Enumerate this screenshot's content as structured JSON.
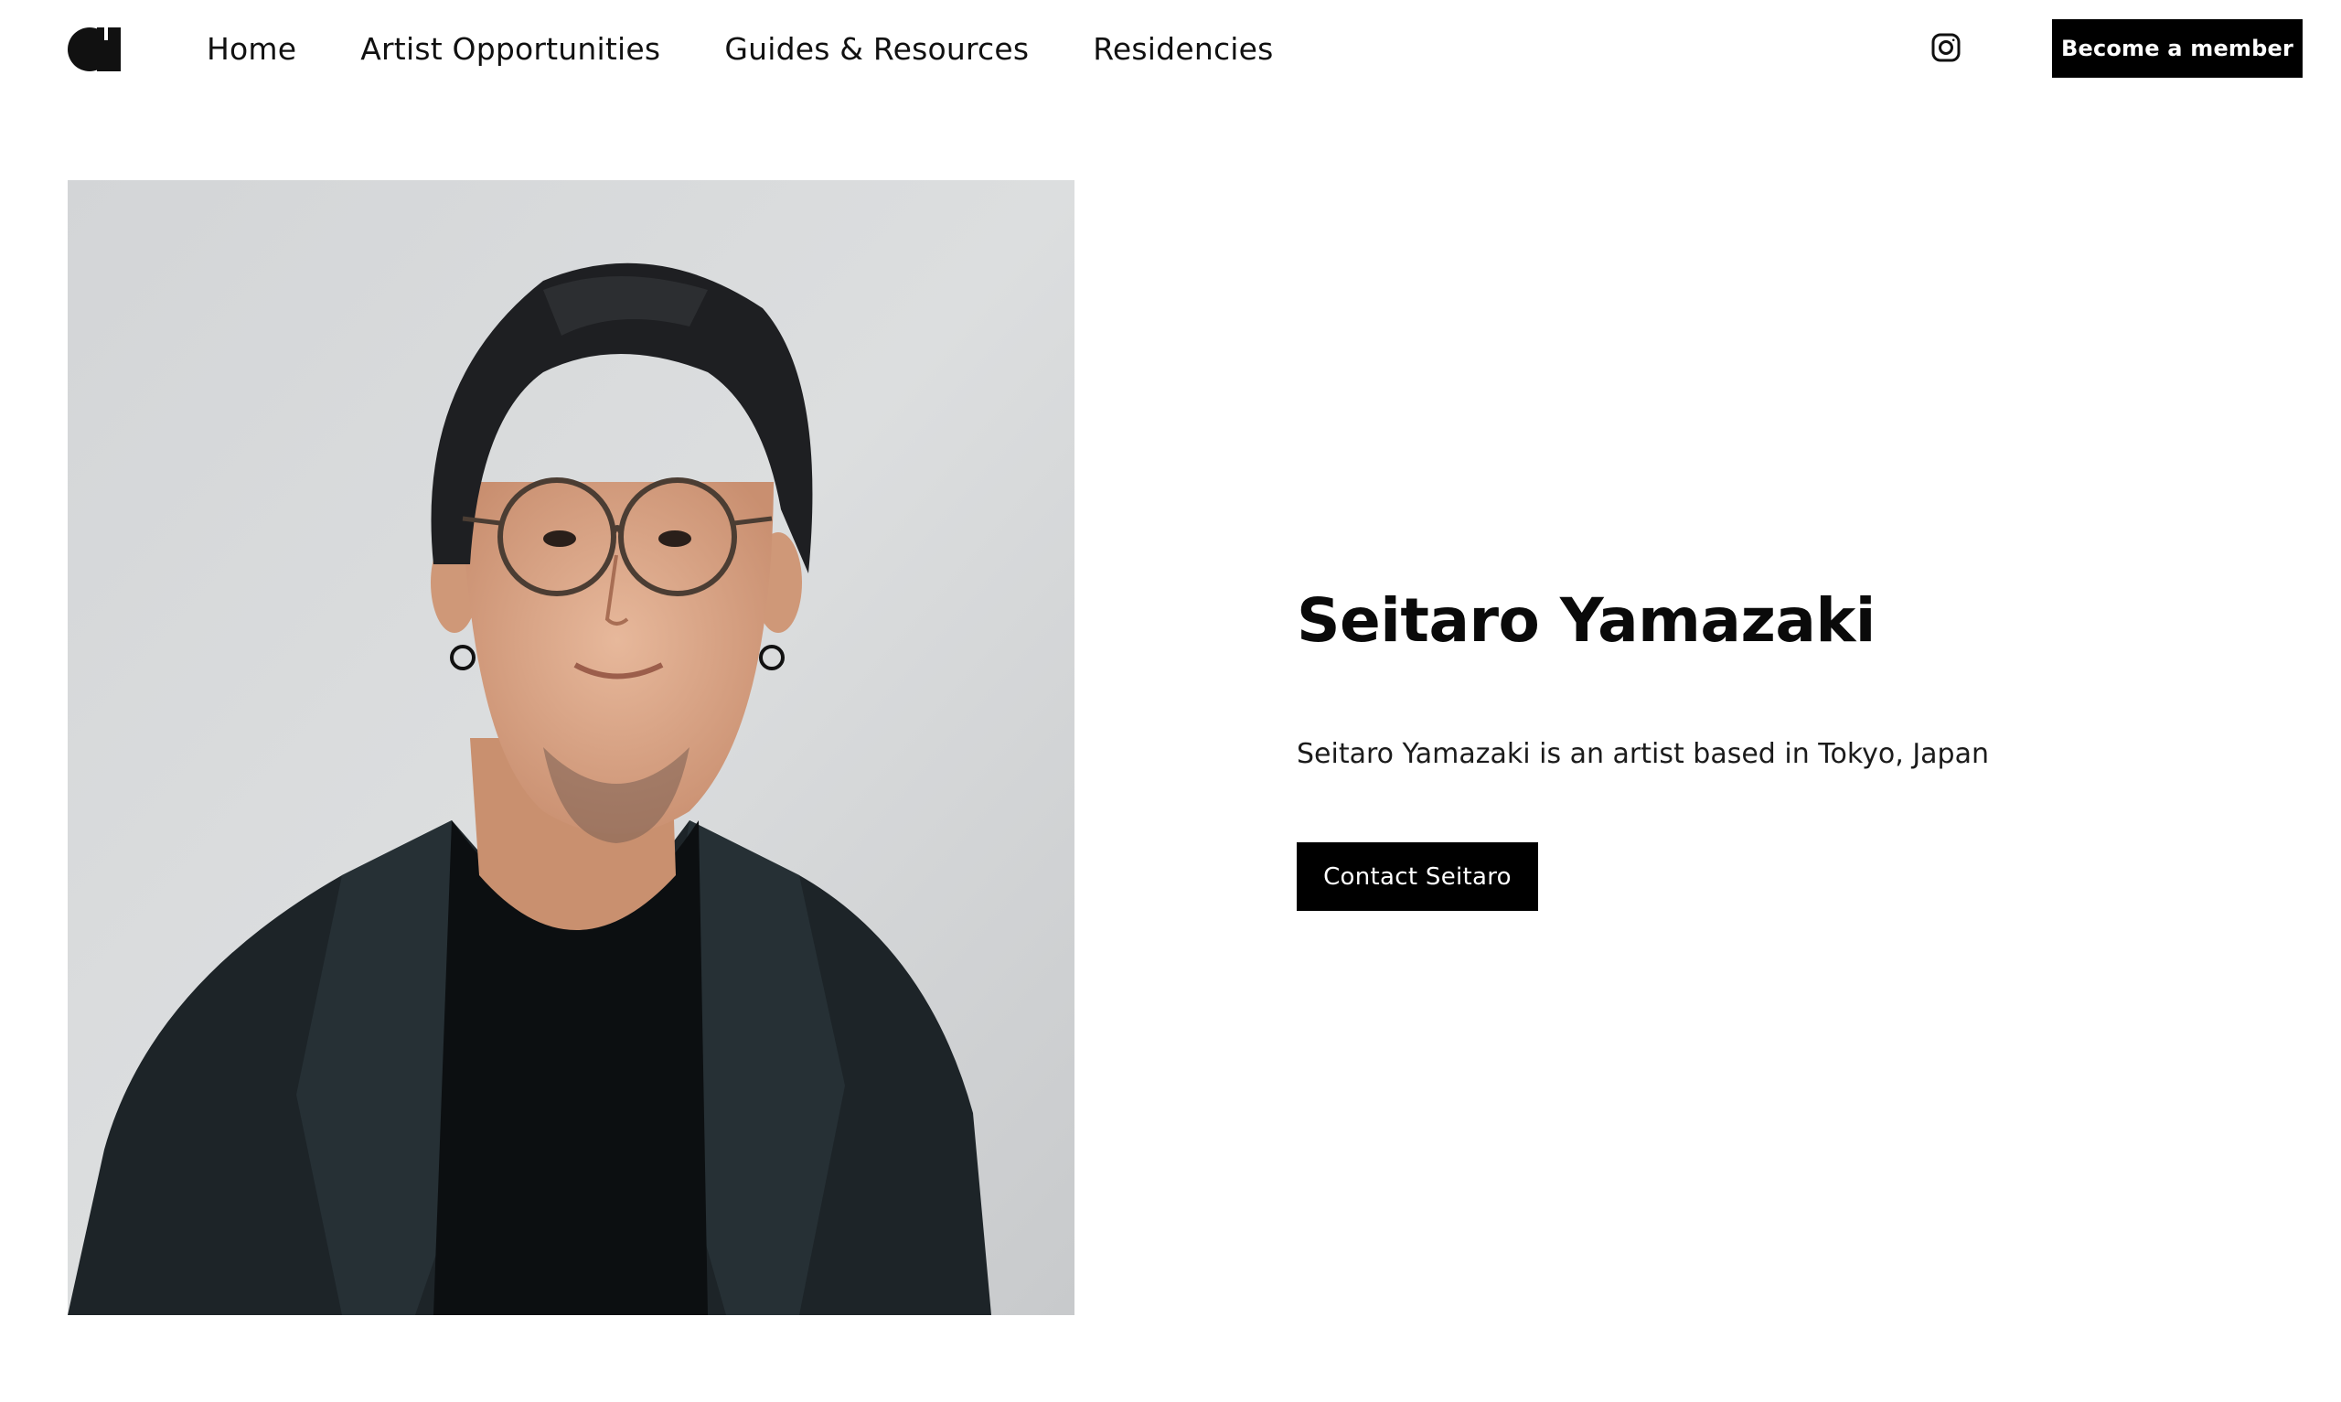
{
  "header": {
    "logo_icon": "brand-logo-icon",
    "nav": [
      {
        "label": "Home"
      },
      {
        "label": "Artist Opportunities"
      },
      {
        "label": "Guides & Resources"
      },
      {
        "label": "Residencies"
      }
    ],
    "instagram_icon": "instagram-icon",
    "member_button": "Become a member"
  },
  "profile": {
    "name": "Seitaro Yamazaki",
    "bio": "Seitaro Yamazaki is an artist based in Tokyo, Japan",
    "contact_button": "Contact Seitaro"
  },
  "colors": {
    "primary": "#000000",
    "background": "#ffffff",
    "photo_backdrop": "#cfd1d3"
  }
}
